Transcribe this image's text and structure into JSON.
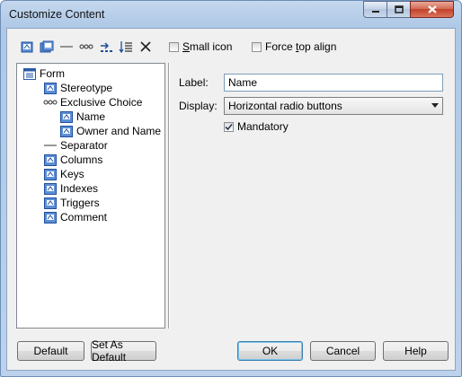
{
  "window": {
    "title": "Customize Content"
  },
  "toolbar": {
    "tools": [
      "add-item-icon",
      "add-group-icon",
      "separator-icon",
      "exclusive-choice-icon",
      "move-right-icon",
      "sort-icon",
      "delete-icon"
    ],
    "small_icon_label": "Small icon",
    "small_icon_checked": false,
    "force_top_label": "Force top align",
    "force_top_checked": false
  },
  "tree": {
    "items": [
      {
        "label": "Form"
      },
      {
        "label": "Stereotype"
      },
      {
        "label": "Exclusive Choice"
      },
      {
        "label": "Name"
      },
      {
        "label": "Owner and Name"
      },
      {
        "label": "Separator"
      },
      {
        "label": "Columns"
      },
      {
        "label": "Keys"
      },
      {
        "label": "Indexes"
      },
      {
        "label": "Triggers"
      },
      {
        "label": "Comment"
      }
    ]
  },
  "props": {
    "label_caption": "Label:",
    "label_value": "Name",
    "display_caption": "Display:",
    "display_value": "Horizontal radio buttons",
    "mandatory_label": "Mandatory",
    "mandatory_checked": true
  },
  "buttons": {
    "default": "Default",
    "set_as_default": "Set As Default",
    "ok": "OK",
    "cancel": "Cancel",
    "help": "Help"
  },
  "colors": {
    "accent": "#3c7fb1",
    "title_bar": "#aec8e6",
    "close": "#c4412a"
  }
}
